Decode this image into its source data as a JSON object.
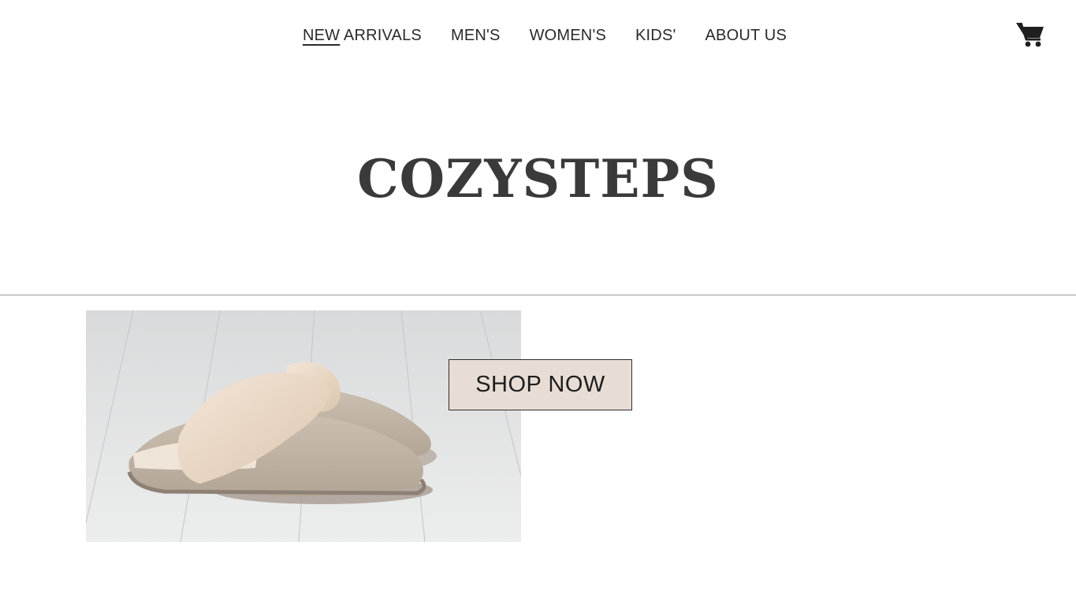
{
  "nav": {
    "items": [
      {
        "label_a": "NEW",
        "label_b": " ARRIVALS"
      },
      {
        "label": "MEN'S"
      },
      {
        "label": "WOMEN'S"
      },
      {
        "label": "KIDS'"
      },
      {
        "label": "ABOUT US"
      }
    ],
    "cart_icon": "shopping-cart-icon"
  },
  "hero": {
    "brand": "COZYSTEPS"
  },
  "promo": {
    "image_subject": "beige fur-lined slippers on white wooden floor",
    "cta_label": "SHOP NOW",
    "cta_color": "#e8ddd5"
  }
}
